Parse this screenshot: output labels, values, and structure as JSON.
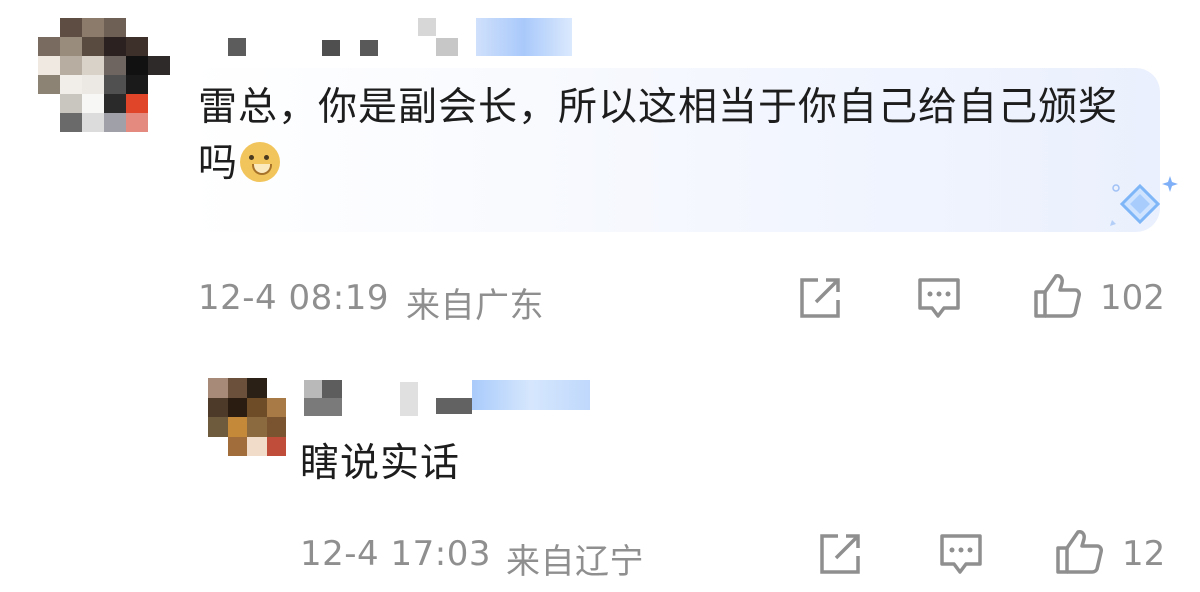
{
  "comment": {
    "text": "雷总，你是副会长，所以这相当于你自己给自己颁奖吗",
    "emoji": "doge-emoji",
    "time": "12-4 08:19",
    "location": "来自广东",
    "likes": "102"
  },
  "reply": {
    "text": "瞎说实话",
    "time": "12-4 17:03",
    "location": "来自辽宁",
    "likes": "12"
  },
  "icons": {
    "share": "share-icon",
    "comment": "comment-icon",
    "like": "thumbs-up-icon"
  },
  "colors": {
    "text": "#1d1d1d",
    "meta": "#8f8f8f",
    "icon": "#8f8f8f",
    "bubble": "#eef3fd"
  }
}
